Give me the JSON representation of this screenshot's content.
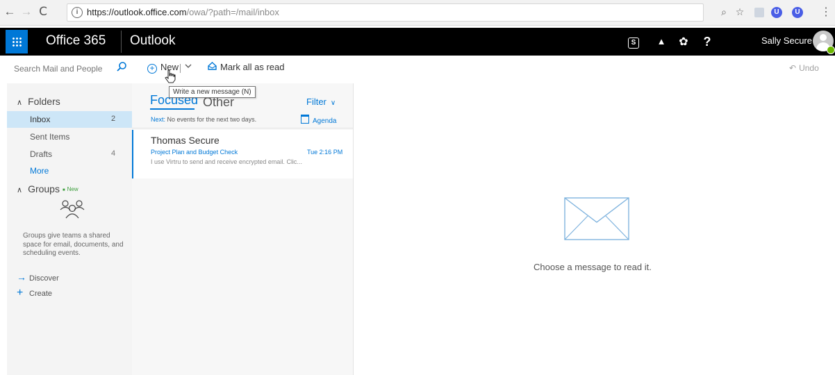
{
  "browser": {
    "url_main": "https://outlook.office.com",
    "url_path": "/owa/?path=/mail/inbox",
    "nav_back": "←",
    "nav_forward": "→",
    "nav_reload": "C",
    "info_glyph": "i",
    "zoom_glyph": "⌕",
    "star_glyph": "☆",
    "menu_glyph": "⋮",
    "ext_badge_letter": "U"
  },
  "suite": {
    "brand": "Office 365",
    "app": "Outlook",
    "skype_glyph": "S",
    "bell_glyph": "▲",
    "gear_glyph": "✿",
    "help_glyph": "?",
    "user_name": "Sally Secure",
    "accent_color": "#0078d7"
  },
  "commands": {
    "search_placeholder": "Search Mail and People",
    "new_label": "New",
    "mark_all_read_label": "Mark all as read",
    "undo_label": "Undo",
    "tooltip": "Write a new message (N)"
  },
  "folders": {
    "heading": "Folders",
    "items": [
      {
        "label": "Inbox",
        "count": "2"
      },
      {
        "label": "Sent Items",
        "count": ""
      },
      {
        "label": "Drafts",
        "count": "4"
      }
    ],
    "more_label": "More"
  },
  "groups": {
    "heading": "Groups",
    "new_badge": "New",
    "description": "Groups give teams a shared space for email, documents, and scheduling events.",
    "discover_label": "Discover",
    "create_label": "Create"
  },
  "message_list": {
    "tab_focused": "Focused",
    "tab_other": "Other",
    "filter_label": "Filter",
    "next_prefix": "Next:",
    "next_text": "No events for the next two days.",
    "agenda_label": "Agenda",
    "messages": [
      {
        "sender": "Thomas Secure",
        "subject": "Project Plan and Budget Check",
        "time": "Tue 2:16 PM",
        "preview": "I use Virtru to send and receive encrypted email. Clic..."
      }
    ]
  },
  "reading_pane": {
    "empty_text": "Choose a message to read it."
  }
}
